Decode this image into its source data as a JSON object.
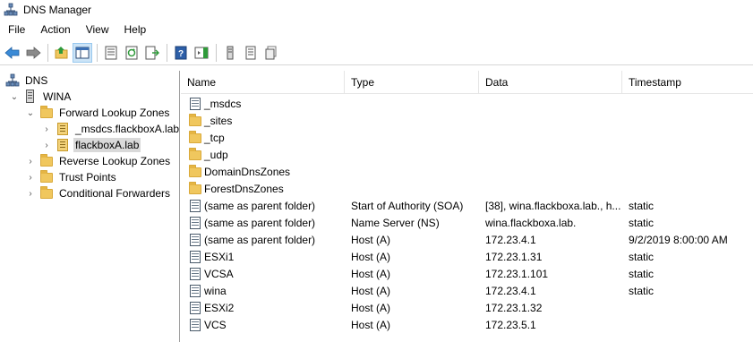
{
  "window": {
    "title": "DNS Manager"
  },
  "menu": [
    "File",
    "Action",
    "View",
    "Help"
  ],
  "toolbar": {
    "buttons": [
      "back-arrow-icon",
      "forward-arrow-icon",
      "up-folder-icon",
      "show-hide-tree-icon",
      "properties-icon",
      "refresh-icon",
      "export-list-icon",
      "help-icon",
      "console-icon",
      "server-icon",
      "list-icon",
      "copy-icon"
    ]
  },
  "tree": {
    "root": "DNS",
    "server": "WINA",
    "forward_zones": "Forward Lookup Zones",
    "zone1": "_msdcs.flackboxA.lab",
    "zone2": "flackboxA.lab",
    "reverse_zones": "Reverse Lookup Zones",
    "trust_points": "Trust Points",
    "conditional_forwarders": "Conditional Forwarders"
  },
  "list": {
    "columns": [
      "Name",
      "Type",
      "Data",
      "Timestamp"
    ],
    "rows": [
      {
        "icon": "zone",
        "name": "_msdcs",
        "type": "",
        "data": "",
        "timestamp": ""
      },
      {
        "icon": "folder",
        "name": "_sites",
        "type": "",
        "data": "",
        "timestamp": ""
      },
      {
        "icon": "folder",
        "name": "_tcp",
        "type": "",
        "data": "",
        "timestamp": ""
      },
      {
        "icon": "folder",
        "name": "_udp",
        "type": "",
        "data": "",
        "timestamp": ""
      },
      {
        "icon": "folder",
        "name": "DomainDnsZones",
        "type": "",
        "data": "",
        "timestamp": ""
      },
      {
        "icon": "folder",
        "name": "ForestDnsZones",
        "type": "",
        "data": "",
        "timestamp": ""
      },
      {
        "icon": "record",
        "name": "(same as parent folder)",
        "type": "Start of Authority (SOA)",
        "data": "[38], wina.flackboxa.lab., h...",
        "timestamp": "static"
      },
      {
        "icon": "record",
        "name": "(same as parent folder)",
        "type": "Name Server (NS)",
        "data": "wina.flackboxa.lab.",
        "timestamp": "static"
      },
      {
        "icon": "record",
        "name": "(same as parent folder)",
        "type": "Host (A)",
        "data": "172.23.4.1",
        "timestamp": "9/2/2019 8:00:00 AM"
      },
      {
        "icon": "record",
        "name": "ESXi1",
        "type": "Host (A)",
        "data": "172.23.1.31",
        "timestamp": "static"
      },
      {
        "icon": "record",
        "name": "VCSA",
        "type": "Host (A)",
        "data": "172.23.1.101",
        "timestamp": "static"
      },
      {
        "icon": "record",
        "name": "wina",
        "type": "Host (A)",
        "data": "172.23.4.1",
        "timestamp": "static"
      },
      {
        "icon": "record",
        "name": "ESXi2",
        "type": "Host (A)",
        "data": "172.23.1.32",
        "timestamp": ""
      },
      {
        "icon": "record",
        "name": "VCS",
        "type": "Host (A)",
        "data": "172.23.5.1",
        "timestamp": ""
      }
    ]
  }
}
